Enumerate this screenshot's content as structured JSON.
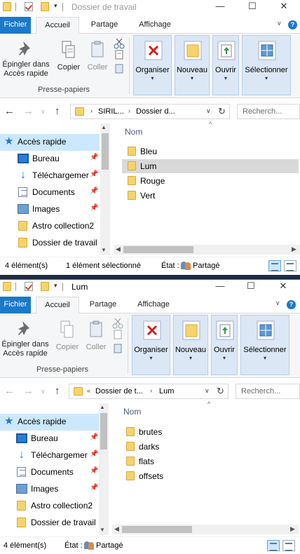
{
  "windows": [
    {
      "title": "Dossier de travail",
      "title_color": "#9a9a9a",
      "ribbon_tabs": [
        "Fichier",
        "Accueil",
        "Partage",
        "Affichage"
      ],
      "ribbon": {
        "pin": "Épingler dans Accès rapide",
        "copy": "Copier",
        "paste": "Coller",
        "clipboard_group": "Presse-papiers",
        "organize": "Organiser",
        "new": "Nouveau",
        "open": "Ouvrir",
        "select": "Sélectionner"
      },
      "address": {
        "crumbs": [
          "SIRIL...",
          "Dossier d..."
        ],
        "prefix": ""
      },
      "search_placeholder": "Recherch...",
      "nav": [
        {
          "label": "Accès rapide",
          "icon": "star-icon"
        },
        {
          "label": "Bureau",
          "icon": "desktop-icon",
          "pinned": true
        },
        {
          "label": "Téléchargemer",
          "icon": "download-icon",
          "pinned": true
        },
        {
          "label": "Documents",
          "icon": "documents-icon",
          "pinned": true
        },
        {
          "label": "Images",
          "icon": "pictures-icon",
          "pinned": true
        },
        {
          "label": "Astro collection2",
          "icon": "folder-icon"
        },
        {
          "label": "Dossier de travail",
          "icon": "folder-icon"
        }
      ],
      "column_header": "Nom",
      "files": [
        "Bleu",
        "Lum",
        "Rouge",
        "Vert"
      ],
      "selected_file": "Lum",
      "status": {
        "count": "4 élément(s)",
        "selection": "1 élément sélectionné",
        "state_label": "État :",
        "state_value": "Partagé"
      }
    },
    {
      "title": "Lum",
      "title_color": "#000000",
      "ribbon_tabs": [
        "Fichier",
        "Accueil",
        "Partage",
        "Affichage"
      ],
      "ribbon": {
        "pin": "Épingler dans Accès rapide",
        "copy": "Copier",
        "paste": "Coller",
        "clipboard_group": "Presse-papiers",
        "organize": "Organiser",
        "new": "Nouveau",
        "open": "Ouvrir",
        "select": "Sélectionner"
      },
      "address": {
        "crumbs": [
          "Dossier de t...",
          "Lum"
        ],
        "prefix": "«"
      },
      "search_placeholder": "Recherch...",
      "nav": [
        {
          "label": "Accès rapide",
          "icon": "star-icon"
        },
        {
          "label": "Bureau",
          "icon": "desktop-icon",
          "pinned": true
        },
        {
          "label": "Téléchargemer",
          "icon": "download-icon",
          "pinned": true
        },
        {
          "label": "Documents",
          "icon": "documents-icon",
          "pinned": true
        },
        {
          "label": "Images",
          "icon": "pictures-icon",
          "pinned": true
        },
        {
          "label": "Astro collection2",
          "icon": "folder-icon"
        },
        {
          "label": "Dossier de travail",
          "icon": "folder-icon"
        }
      ],
      "column_header": "Nom",
      "files": [
        "brutes",
        "darks",
        "flats",
        "offsets"
      ],
      "selected_file": "",
      "status": {
        "count": "4 élément(s)",
        "selection": "",
        "state_label": "État :",
        "state_value": "Partagé"
      }
    }
  ],
  "colors": {
    "accent": "#1979ca",
    "selection": "#cce8ff",
    "folder": "#f7d36b"
  }
}
